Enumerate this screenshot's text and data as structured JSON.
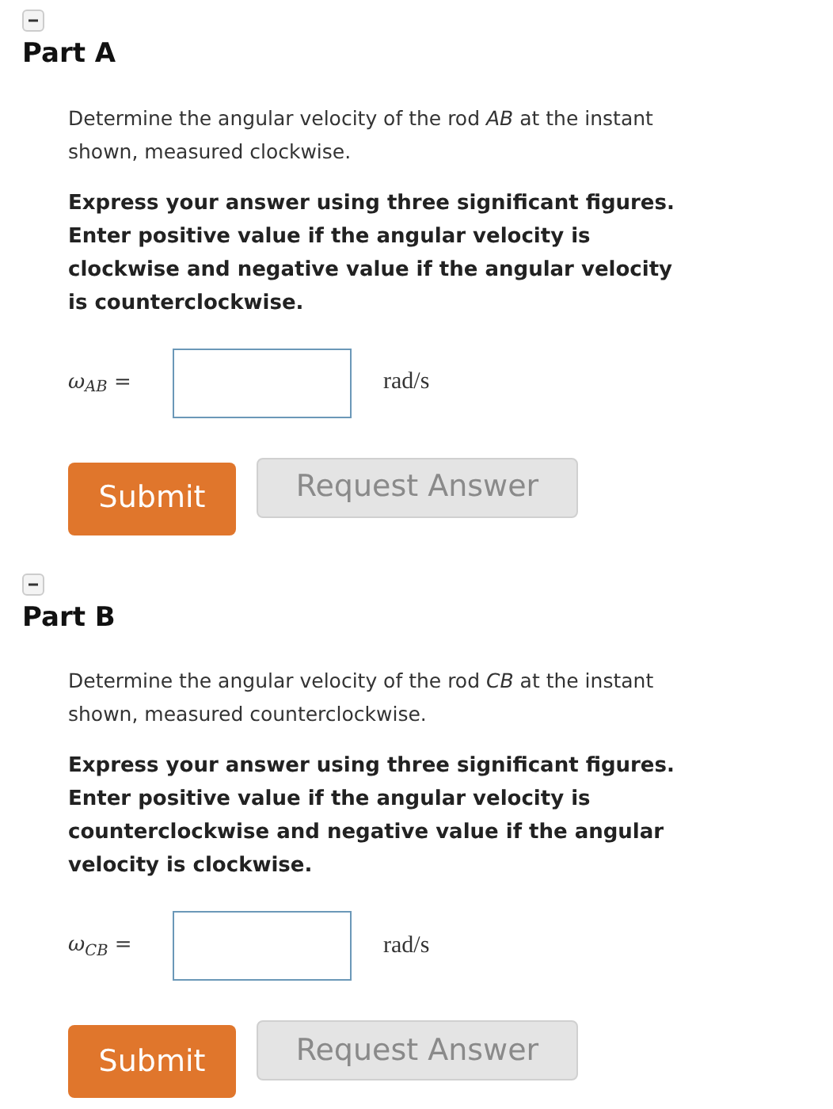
{
  "parts": [
    {
      "title": "Part A",
      "expanded": true,
      "prompt": "Determine the angular velocity of the rod *AB* at the instant shown, measured clockwise.",
      "instruction": "Express your answer using three significant figures. Enter positive value if the angular velocity is clockwise and negative value if the angular velocity is counterclockwise.",
      "answer_label": "ω$_{AB}$ =",
      "unit": "rad/s",
      "buttons": [
        {
          "label": "Submit",
          "kind": "primary",
          "disabled": false
        },
        {
          "label": "Request Answer",
          "kind": "secondary",
          "disabled": true
        }
      ]
    },
    {
      "title": "Part B",
      "expanded": true,
      "prompt": "Determine the angular velocity of the rod *CB* at the instant shown, measured counterclockwise.",
      "instruction": "Express your answer using three significant figures. Enter positive value if the angular velocity is counterclockwise and negative value if the angular velocity is clockwise.",
      "answer_label": "ω$_{CB}$ =",
      "unit": "rad/s",
      "buttons": [
        {
          "label": "Submit",
          "kind": "primary",
          "disabled": false
        },
        {
          "label": "Request Answer",
          "kind": "secondary",
          "disabled": true
        }
      ]
    }
  ]
}
